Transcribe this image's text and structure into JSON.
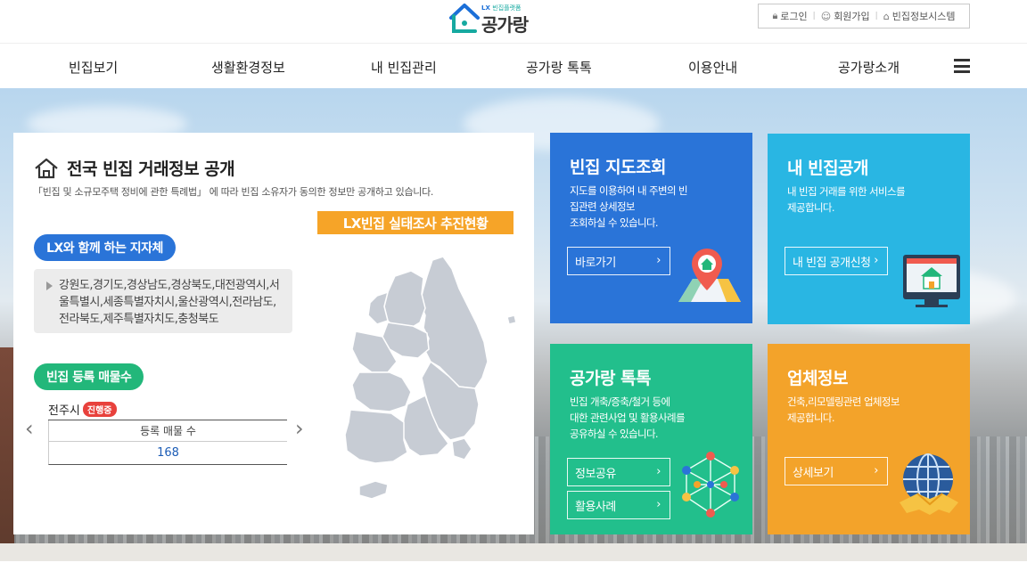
{
  "header": {
    "logo": {
      "brand_small": "LX",
      "brand_small_sub": "빈집플랫폼",
      "name": "공가랑"
    },
    "util": {
      "login": "로그인",
      "signup": "회원가입",
      "system": "빈집정보시스템"
    }
  },
  "nav": {
    "items": [
      {
        "label": "빈집보기"
      },
      {
        "label": "생활환경정보"
      },
      {
        "label": "내 빈집관리"
      },
      {
        "label": "공가랑 톡톡"
      },
      {
        "label": "이용안내"
      },
      {
        "label": "공가랑소개"
      }
    ]
  },
  "panel": {
    "title": "전국 빈집 거래정보 공개",
    "desc": "「빈집 및 소규모주택 정비에 관한 특례법」 에 따라 빈집 소유자가 동의한 정보만 공개하고 있습니다.",
    "survey_label": "LX빈집 실태조사 추진현황",
    "partners_label": "LX와 함께 하는 지자체",
    "regions": "강원도,경기도,경상남도,경상북도,대전광역시,서울특별시,세종특별자치시,울산광역시,전라남도,전라북도,제주특별자치도,충청북도",
    "listings_label": "빈집 등록 매물수",
    "city": "전주시",
    "status_badge": "진행중",
    "table_header": "등록 매물 수",
    "count": "168"
  },
  "cards": [
    {
      "title": "빈집 지도조회",
      "desc": [
        "지도를 이용하여 내 주변의 빈",
        "집관련 상세정보",
        "조회하실 수 있습니다."
      ],
      "buttons": [
        "바로가기"
      ]
    },
    {
      "title": "내 빈집공개",
      "desc": [
        "내 빈집 거래를 위한 서비스를",
        "제공합니다."
      ],
      "buttons": [
        "내 빈집 공개신청"
      ]
    },
    {
      "title": "공가랑 톡톡",
      "desc": [
        "빈집 개축/증축/철거 등에",
        "대한 관련사업 및 활용사례를",
        "공유하실 수 있습니다."
      ],
      "buttons": [
        "정보공유",
        "활용사례"
      ]
    },
    {
      "title": "업체정보",
      "desc": [
        "건축,리모델링관련 업체정보",
        "제공합니다."
      ],
      "buttons": [
        "상세보기"
      ]
    }
  ],
  "colors": {
    "blue": "#2a74d8",
    "sky": "#29b6e3",
    "green": "#22bf8c",
    "orange": "#f3a32a",
    "survey": "#f6a428",
    "badge": "#e8413c"
  }
}
